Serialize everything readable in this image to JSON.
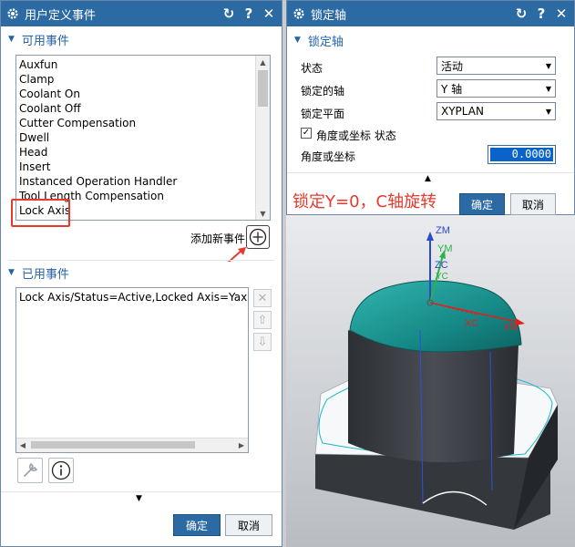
{
  "left_dialog": {
    "title": "用户定义事件",
    "title_buttons": [
      "↻",
      "?",
      "✕"
    ],
    "section_available": "可用事件",
    "available_events": [
      "Auxfun",
      "Clamp",
      "Coolant On",
      "Coolant Off",
      "Cutter Compensation",
      "Dwell",
      "Head",
      "Insert",
      "Instanced Operation Handler",
      "Tool Length Compensation",
      "Lock Axis"
    ],
    "add_new_event_label": "添加新事件",
    "section_used": "已用事件",
    "used_events": [
      "Lock Axis/Status=Active,Locked Axis=Yaxis,Loc"
    ],
    "ok_label": "确定",
    "cancel_label": "取消"
  },
  "right_dialog": {
    "title": "锁定轴",
    "title_buttons": [
      "↻",
      "?",
      "✕"
    ],
    "section": "锁定轴",
    "fields": [
      {
        "label": "状态",
        "value": "活动"
      },
      {
        "label": "锁定的轴",
        "value": "Y 轴"
      },
      {
        "label": "锁定平面",
        "value": "XYPLAN"
      }
    ],
    "checkbox_label": "角度或坐标 状态",
    "checkbox_checked": true,
    "angle_label": "角度或坐标",
    "angle_value": "0.0000",
    "ok_label": "确定",
    "cancel_label": "取消"
  },
  "annotation": {
    "text": "锁定Y=0，C轴旋转"
  },
  "viewport": {
    "axis_labels": [
      "ZM",
      "YM",
      "ZC",
      "YC",
      "XC",
      "XM"
    ]
  },
  "colors": {
    "title_bar": "#2c6aa3",
    "section_text": "#2464a8",
    "highlight": "#e53b2c",
    "model_top": "#1a8f8f",
    "model_body": "#3a3d42"
  }
}
